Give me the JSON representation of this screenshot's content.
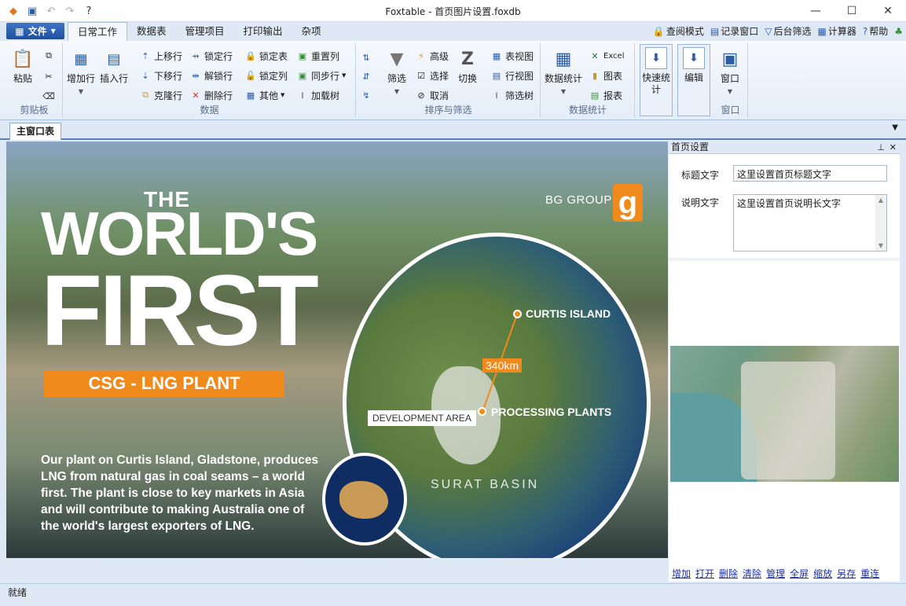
{
  "window": {
    "title": "Foxtable - 首页图片设置.foxdb",
    "minimize": "—",
    "maximize": "☐",
    "close": "✕"
  },
  "ribbon_tabs": {
    "file": "文件",
    "tabs": [
      "日常工作",
      "数据表",
      "管理项目",
      "打印输出",
      "杂项"
    ],
    "right_tools": [
      "查阅模式",
      "记录窗口",
      "后台筛选",
      "计算器",
      "帮助"
    ]
  },
  "groups": {
    "clipboard": {
      "label": "剪贴板",
      "paste": "粘贴"
    },
    "data": {
      "label": "数据",
      "add_row": "增加行",
      "insert_row": "插入行",
      "small": [
        "上移行",
        "锁定行",
        "锁定表",
        "重置列",
        "下移行",
        "解锁行",
        "锁定列",
        "同步行",
        "克隆行",
        "删除行",
        "其他",
        "加载树"
      ]
    },
    "sort_filter": {
      "label": "排序与筛选",
      "filter": "筛选",
      "advanced": "高级",
      "select": "选择",
      "cancel": "取消",
      "switch": "切换",
      "table_view": "表视图",
      "row_view": "行视图",
      "filter_tree": "筛选树"
    },
    "stats": {
      "label": "数据统计",
      "data_stats": "数据统计",
      "excel": "Excel",
      "chart": "图表",
      "report": "报表"
    },
    "quick_stats": "快速统计",
    "edit": "编辑",
    "window": {
      "label": "窗口",
      "btn": "窗口"
    }
  },
  "doc_tab": "主窗口表",
  "image": {
    "the": "THE",
    "worlds": "WORLD'S",
    "first": "FIRST",
    "banner": "CSG - LNG PLANT",
    "desc": "Our plant on Curtis Island, Gladstone, produces LNG from natural gas in coal seams – a world first. The plant is close to key markets in Asia and will contribute to making Australia one of the world's largest exporters of LNG.",
    "brand": "BG GROUP",
    "brand_logo": "g",
    "curtis": "CURTIS ISLAND",
    "distance": "340km",
    "processing": "PROCESSING PLANTS",
    "development": "DEVELOPMENT AREA",
    "surat": "SURAT BASIN"
  },
  "panel": {
    "title": "首页设置",
    "title_label": "标题文字",
    "title_value": "这里设置首页标题文字",
    "desc_label": "说明文字",
    "desc_value": "这里设置首页说明长文字",
    "links": [
      "增加",
      "打开",
      "删除",
      "清除",
      "管理",
      "全屏",
      "缩放",
      "另存",
      "重连"
    ]
  },
  "status": "就绪"
}
